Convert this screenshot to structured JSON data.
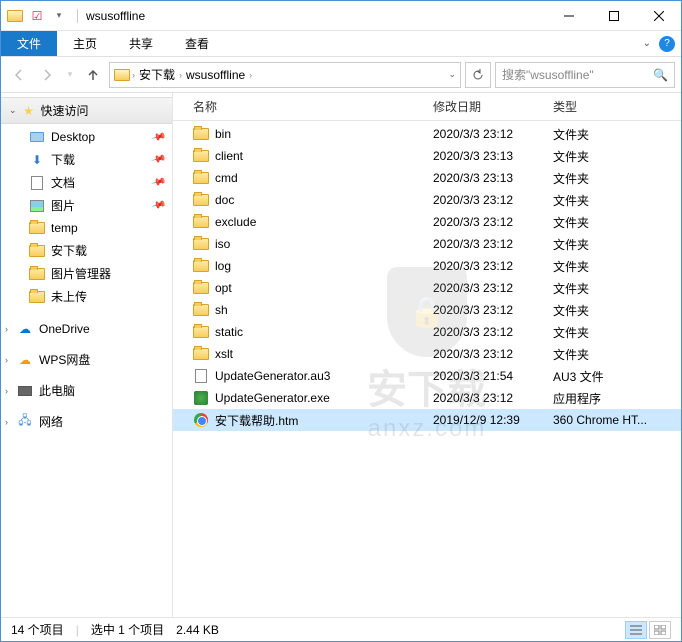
{
  "title": "wsusoffline",
  "ribbon": {
    "file": "文件",
    "home": "主页",
    "share": "共享",
    "view": "查看"
  },
  "breadcrumb": [
    "安下载",
    "wsusoffline"
  ],
  "search_placeholder": "搜索\"wsusoffline\"",
  "sidebar": {
    "quick_access": "快速访问",
    "items": [
      {
        "label": "Desktop",
        "icon": "desktop",
        "pinned": true
      },
      {
        "label": "下载",
        "icon": "download",
        "pinned": true
      },
      {
        "label": "文档",
        "icon": "doc",
        "pinned": true
      },
      {
        "label": "图片",
        "icon": "img",
        "pinned": true
      },
      {
        "label": "temp",
        "icon": "folder",
        "pinned": false
      },
      {
        "label": "安下载",
        "icon": "folder",
        "pinned": false
      },
      {
        "label": "图片管理器",
        "icon": "folder",
        "pinned": false
      },
      {
        "label": "未上传",
        "icon": "folder",
        "pinned": false
      }
    ],
    "roots": [
      {
        "label": "OneDrive",
        "icon": "cloud"
      },
      {
        "label": "WPS网盘",
        "icon": "wps"
      },
      {
        "label": "此电脑",
        "icon": "pc"
      },
      {
        "label": "网络",
        "icon": "net"
      }
    ]
  },
  "columns": {
    "name": "名称",
    "date": "修改日期",
    "type": "类型"
  },
  "files": [
    {
      "name": "bin",
      "date": "2020/3/3 23:12",
      "type": "文件夹",
      "icon": "folder"
    },
    {
      "name": "client",
      "date": "2020/3/3 23:13",
      "type": "文件夹",
      "icon": "folder"
    },
    {
      "name": "cmd",
      "date": "2020/3/3 23:13",
      "type": "文件夹",
      "icon": "folder"
    },
    {
      "name": "doc",
      "date": "2020/3/3 23:12",
      "type": "文件夹",
      "icon": "folder"
    },
    {
      "name": "exclude",
      "date": "2020/3/3 23:12",
      "type": "文件夹",
      "icon": "folder"
    },
    {
      "name": "iso",
      "date": "2020/3/3 23:12",
      "type": "文件夹",
      "icon": "folder"
    },
    {
      "name": "log",
      "date": "2020/3/3 23:12",
      "type": "文件夹",
      "icon": "folder"
    },
    {
      "name": "opt",
      "date": "2020/3/3 23:12",
      "type": "文件夹",
      "icon": "folder"
    },
    {
      "name": "sh",
      "date": "2020/3/3 23:12",
      "type": "文件夹",
      "icon": "folder"
    },
    {
      "name": "static",
      "date": "2020/3/3 23:12",
      "type": "文件夹",
      "icon": "folder"
    },
    {
      "name": "xslt",
      "date": "2020/3/3 23:12",
      "type": "文件夹",
      "icon": "folder"
    },
    {
      "name": "UpdateGenerator.au3",
      "date": "2020/3/3 21:54",
      "type": "AU3 文件",
      "icon": "au3"
    },
    {
      "name": "UpdateGenerator.exe",
      "date": "2020/3/3 23:12",
      "type": "应用程序",
      "icon": "exe"
    },
    {
      "name": "安下载帮助.htm",
      "date": "2019/12/9 12:39",
      "type": "360 Chrome HT...",
      "icon": "chrome",
      "selected": true
    }
  ],
  "status": {
    "count": "14 个项目",
    "selected": "选中 1 个项目",
    "size": "2.44 KB"
  },
  "watermark": {
    "line1": "安下载",
    "line2": "anxz.com"
  }
}
